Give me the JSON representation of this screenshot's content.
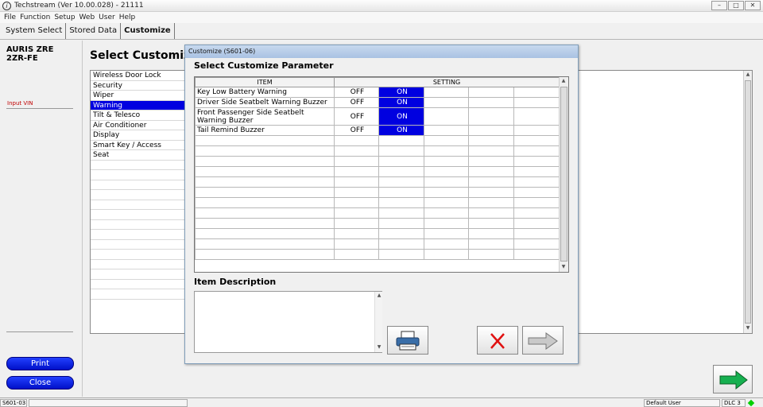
{
  "window": {
    "title": "Techstream (Ver 10.00.028) - 21111",
    "app_icon": "i"
  },
  "menu": [
    "File",
    "Function",
    "Setup",
    "Web",
    "User",
    "Help"
  ],
  "tabs": [
    {
      "label": "System Select",
      "active": false
    },
    {
      "label": "Stored Data",
      "active": false
    },
    {
      "label": "Customize",
      "active": true
    }
  ],
  "vehicle": {
    "model": "AURIS ZRE",
    "engine": "2ZR-FE"
  },
  "vin": {
    "label": "Input VIN"
  },
  "left_buttons": {
    "print": "Print",
    "close": "Close"
  },
  "main": {
    "title": "Select Customize F",
    "functions": [
      "Wireless Door Lock",
      "Security",
      "Wiper",
      "Warning",
      "Tilt & Telesco",
      "Air Conditioner",
      "Display",
      "Smart Key / Access",
      "Seat"
    ],
    "selected_index": 3
  },
  "dialog": {
    "title": "Customize (S601-06)",
    "heading": "Select Customize Parameter",
    "columns": {
      "item": "ITEM",
      "setting": "SETTING"
    },
    "rows": [
      {
        "item": "Key Low Battery Warning",
        "off": "OFF",
        "on": "ON",
        "selected": "ON"
      },
      {
        "item": "Driver Side Seatbelt Warning Buzzer",
        "off": "OFF",
        "on": "ON",
        "selected": "ON"
      },
      {
        "item": "Front Passenger Side Seatbelt Warning Buzzer",
        "off": "OFF",
        "on": "ON",
        "selected": "ON"
      },
      {
        "item": "Tail Remind Buzzer",
        "off": "OFF",
        "on": "ON",
        "selected": "ON"
      }
    ],
    "description_label": "Item Description",
    "description_text": ""
  },
  "status": {
    "screen_id": "S601-03",
    "user": "Default User",
    "connection": "DLC 3"
  },
  "icons": {
    "print": "printer-icon",
    "cancel": "red-x-icon",
    "next": "right-arrow-icon",
    "next_main": "green-arrow-icon"
  },
  "colors": {
    "selection": "#0000e0",
    "pill_button": "#1a30f0",
    "vin_label": "#c00000",
    "status_ok": "#00d000"
  }
}
